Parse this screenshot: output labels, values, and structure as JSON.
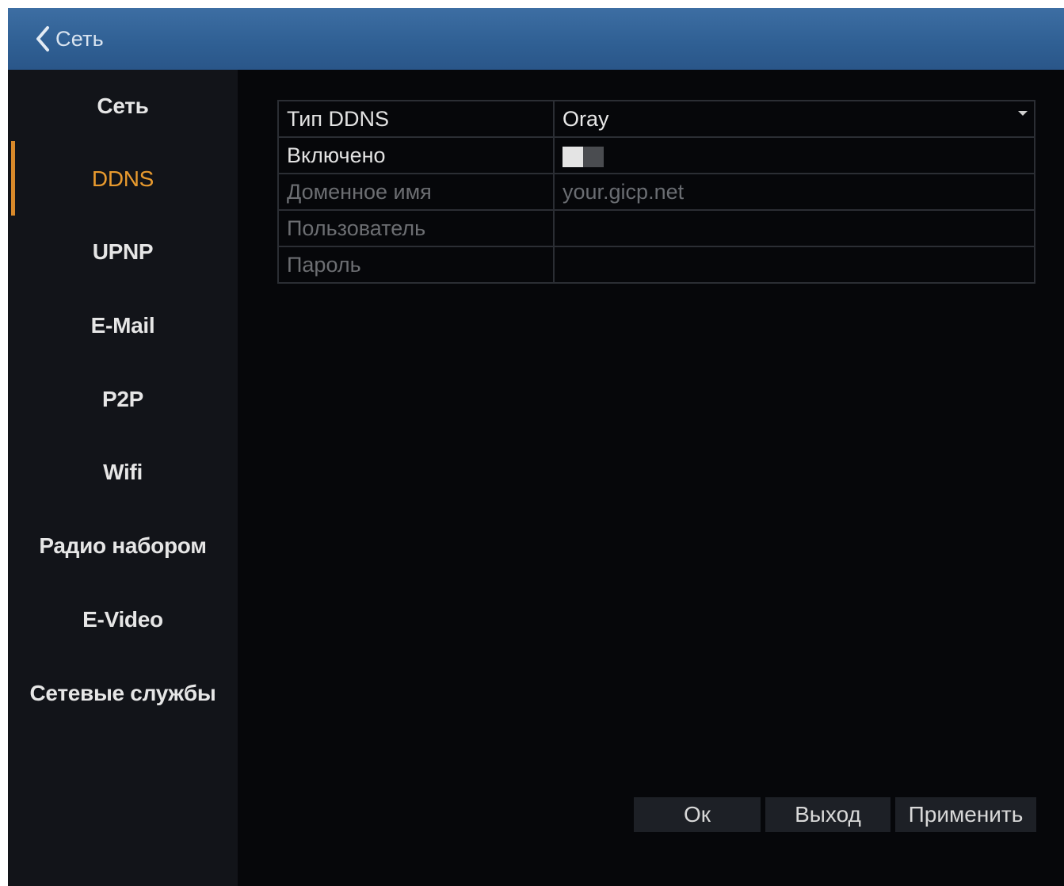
{
  "titlebar": {
    "title": "Сеть",
    "back_icon": "chevron-left-icon"
  },
  "sidebar": {
    "items": [
      {
        "label": "Сеть",
        "active": false
      },
      {
        "label": "DDNS",
        "active": true
      },
      {
        "label": "UPNP",
        "active": false
      },
      {
        "label": "E-Mail",
        "active": false
      },
      {
        "label": "P2P",
        "active": false
      },
      {
        "label": "Wifi",
        "active": false
      },
      {
        "label": "Радио набором",
        "active": false
      },
      {
        "label": "E-Video",
        "active": false
      },
      {
        "label": "Сетевые службы",
        "active": false
      }
    ]
  },
  "form": {
    "ddns_type": {
      "label": "Тип DDNS",
      "value": "Oray"
    },
    "enabled": {
      "label": "Включено",
      "on": false
    },
    "domain": {
      "label": "Доменное имя",
      "value": "your.gicp.net"
    },
    "user": {
      "label": "Пользователь",
      "value": ""
    },
    "password": {
      "label": "Пароль",
      "value": ""
    }
  },
  "buttons": {
    "ok": "Ок",
    "exit": "Выход",
    "apply": "Применить"
  },
  "colors": {
    "accent": "#e89a2e",
    "titlebar": "#2f5f93",
    "background": "#06070a",
    "sidebar": "#121419"
  }
}
